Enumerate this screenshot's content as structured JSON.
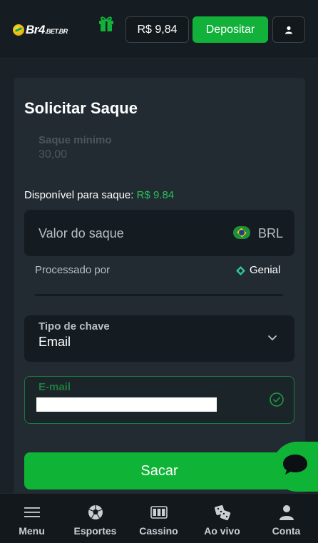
{
  "header": {
    "logo_text": "Br4",
    "logo_suffix": ".BET.BR",
    "balance": "R$ 9,84",
    "deposit_label": "Depositar"
  },
  "form": {
    "title": "Solicitar Saque",
    "min_label": "Saque mínimo",
    "min_value": "30,00",
    "available_label": "Disponível para saque:",
    "available_amount": "R$ 9.84",
    "amount_placeholder": "Valor do saque",
    "currency": "BRL",
    "processed_label": "Processado por",
    "processor": "Genial",
    "key_type_label": "Tipo de chave",
    "key_type_value": "Email",
    "email_label": "E-mail",
    "email_value": "",
    "submit_label": "Sacar"
  },
  "bottom_nav": {
    "items": [
      {
        "label": "Menu",
        "icon": "menu-icon"
      },
      {
        "label": "Esportes",
        "icon": "soccer-ball-icon"
      },
      {
        "label": "Cassino",
        "icon": "slot-machine-icon"
      },
      {
        "label": "Ao vivo",
        "icon": "dice-icon"
      },
      {
        "label": "Conta",
        "icon": "user-icon"
      }
    ]
  },
  "colors": {
    "accent_green": "#12b13a",
    "available_green": "#28c15a",
    "background": "#1a2127",
    "card": "#222b32"
  }
}
